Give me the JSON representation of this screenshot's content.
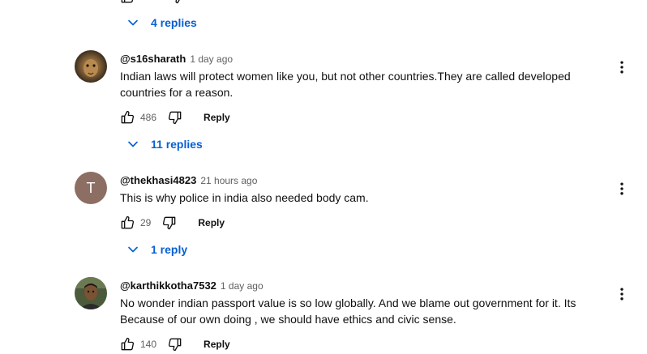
{
  "top_thread": {
    "replies_label": "4 replies"
  },
  "comments": [
    {
      "author": "@s16sharath",
      "time": "1 day ago",
      "text": "Indian laws will protect women like you, but not other countries.They are called developed countries for a reason.",
      "likes": "486",
      "reply_label": "Reply",
      "replies_label": "11 replies"
    },
    {
      "author": "@thekhasi4823",
      "time": "21 hours ago",
      "avatar_letter": "T",
      "avatar_color": "#8d6e63",
      "text": "This is why police in india also needed body cam.",
      "likes": "29",
      "reply_label": "Reply",
      "replies_label": "1 reply"
    },
    {
      "author": "@karthikkotha7532",
      "time": "1 day ago",
      "text": "No wonder indian passport value is so low globally. And we blame out government for it. Its Because of our own doing , we should have ethics and civic sense.",
      "likes": "140",
      "reply_label": "Reply"
    }
  ],
  "colors": {
    "link_blue": "#065fd4",
    "secondary_text": "#606060",
    "primary_text": "#0f0f0f"
  },
  "icons": [
    "like-icon",
    "dislike-icon",
    "chevron-down-icon",
    "more-vert-icon"
  ]
}
